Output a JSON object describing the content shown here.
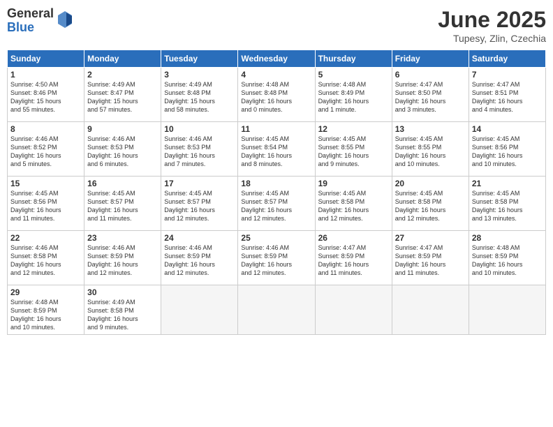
{
  "logo": {
    "general": "General",
    "blue": "Blue"
  },
  "title": "June 2025",
  "location": "Tupesy, Zlin, Czechia",
  "days_of_week": [
    "Sunday",
    "Monday",
    "Tuesday",
    "Wednesday",
    "Thursday",
    "Friday",
    "Saturday"
  ],
  "weeks": [
    [
      {
        "day": "1",
        "info": "Sunrise: 4:50 AM\nSunset: 8:46 PM\nDaylight: 15 hours\nand 55 minutes."
      },
      {
        "day": "2",
        "info": "Sunrise: 4:49 AM\nSunset: 8:47 PM\nDaylight: 15 hours\nand 57 minutes."
      },
      {
        "day": "3",
        "info": "Sunrise: 4:49 AM\nSunset: 8:48 PM\nDaylight: 15 hours\nand 58 minutes."
      },
      {
        "day": "4",
        "info": "Sunrise: 4:48 AM\nSunset: 8:48 PM\nDaylight: 16 hours\nand 0 minutes."
      },
      {
        "day": "5",
        "info": "Sunrise: 4:48 AM\nSunset: 8:49 PM\nDaylight: 16 hours\nand 1 minute."
      },
      {
        "day": "6",
        "info": "Sunrise: 4:47 AM\nSunset: 8:50 PM\nDaylight: 16 hours\nand 3 minutes."
      },
      {
        "day": "7",
        "info": "Sunrise: 4:47 AM\nSunset: 8:51 PM\nDaylight: 16 hours\nand 4 minutes."
      }
    ],
    [
      {
        "day": "8",
        "info": "Sunrise: 4:46 AM\nSunset: 8:52 PM\nDaylight: 16 hours\nand 5 minutes."
      },
      {
        "day": "9",
        "info": "Sunrise: 4:46 AM\nSunset: 8:53 PM\nDaylight: 16 hours\nand 6 minutes."
      },
      {
        "day": "10",
        "info": "Sunrise: 4:46 AM\nSunset: 8:53 PM\nDaylight: 16 hours\nand 7 minutes."
      },
      {
        "day": "11",
        "info": "Sunrise: 4:45 AM\nSunset: 8:54 PM\nDaylight: 16 hours\nand 8 minutes."
      },
      {
        "day": "12",
        "info": "Sunrise: 4:45 AM\nSunset: 8:55 PM\nDaylight: 16 hours\nand 9 minutes."
      },
      {
        "day": "13",
        "info": "Sunrise: 4:45 AM\nSunset: 8:55 PM\nDaylight: 16 hours\nand 10 minutes."
      },
      {
        "day": "14",
        "info": "Sunrise: 4:45 AM\nSunset: 8:56 PM\nDaylight: 16 hours\nand 10 minutes."
      }
    ],
    [
      {
        "day": "15",
        "info": "Sunrise: 4:45 AM\nSunset: 8:56 PM\nDaylight: 16 hours\nand 11 minutes."
      },
      {
        "day": "16",
        "info": "Sunrise: 4:45 AM\nSunset: 8:57 PM\nDaylight: 16 hours\nand 11 minutes."
      },
      {
        "day": "17",
        "info": "Sunrise: 4:45 AM\nSunset: 8:57 PM\nDaylight: 16 hours\nand 12 minutes."
      },
      {
        "day": "18",
        "info": "Sunrise: 4:45 AM\nSunset: 8:57 PM\nDaylight: 16 hours\nand 12 minutes."
      },
      {
        "day": "19",
        "info": "Sunrise: 4:45 AM\nSunset: 8:58 PM\nDaylight: 16 hours\nand 12 minutes."
      },
      {
        "day": "20",
        "info": "Sunrise: 4:45 AM\nSunset: 8:58 PM\nDaylight: 16 hours\nand 12 minutes."
      },
      {
        "day": "21",
        "info": "Sunrise: 4:45 AM\nSunset: 8:58 PM\nDaylight: 16 hours\nand 13 minutes."
      }
    ],
    [
      {
        "day": "22",
        "info": "Sunrise: 4:46 AM\nSunset: 8:58 PM\nDaylight: 16 hours\nand 12 minutes."
      },
      {
        "day": "23",
        "info": "Sunrise: 4:46 AM\nSunset: 8:59 PM\nDaylight: 16 hours\nand 12 minutes."
      },
      {
        "day": "24",
        "info": "Sunrise: 4:46 AM\nSunset: 8:59 PM\nDaylight: 16 hours\nand 12 minutes."
      },
      {
        "day": "25",
        "info": "Sunrise: 4:46 AM\nSunset: 8:59 PM\nDaylight: 16 hours\nand 12 minutes."
      },
      {
        "day": "26",
        "info": "Sunrise: 4:47 AM\nSunset: 8:59 PM\nDaylight: 16 hours\nand 11 minutes."
      },
      {
        "day": "27",
        "info": "Sunrise: 4:47 AM\nSunset: 8:59 PM\nDaylight: 16 hours\nand 11 minutes."
      },
      {
        "day": "28",
        "info": "Sunrise: 4:48 AM\nSunset: 8:59 PM\nDaylight: 16 hours\nand 10 minutes."
      }
    ],
    [
      {
        "day": "29",
        "info": "Sunrise: 4:48 AM\nSunset: 8:59 PM\nDaylight: 16 hours\nand 10 minutes."
      },
      {
        "day": "30",
        "info": "Sunrise: 4:49 AM\nSunset: 8:58 PM\nDaylight: 16 hours\nand 9 minutes."
      },
      {
        "day": "",
        "info": ""
      },
      {
        "day": "",
        "info": ""
      },
      {
        "day": "",
        "info": ""
      },
      {
        "day": "",
        "info": ""
      },
      {
        "day": "",
        "info": ""
      }
    ]
  ]
}
